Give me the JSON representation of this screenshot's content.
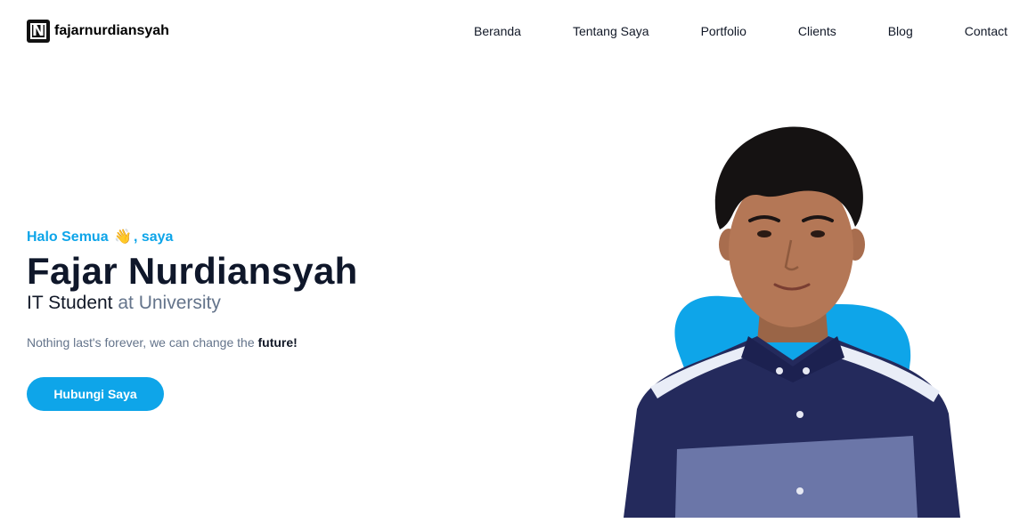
{
  "brand": {
    "logo_letter": "N",
    "name": "fajarnurdiansyah"
  },
  "nav": {
    "items": [
      {
        "label": "Beranda"
      },
      {
        "label": "Tentang Saya"
      },
      {
        "label": "Portfolio"
      },
      {
        "label": "Clients"
      },
      {
        "label": "Blog"
      },
      {
        "label": "Contact"
      }
    ]
  },
  "hero": {
    "greeting_prefix": "Halo Semua",
    "wave_emoji": "👋",
    "greeting_suffix": ", saya",
    "name": "Fajar Nurdiansyah",
    "role": "IT Student",
    "role_suffix": " at University",
    "tagline_prefix": "Nothing last's forever, we can change the ",
    "tagline_emphasis": "future!",
    "cta_label": "Hubungi Saya"
  },
  "colors": {
    "accent": "#0ea5e9",
    "heading": "#0f172a",
    "muted": "#64748b",
    "shirt_dark": "#242a5c",
    "shirt_light": "#6b76a8"
  },
  "icons": {
    "logo": "n-logo-icon",
    "wave": "waving-hand-icon"
  }
}
